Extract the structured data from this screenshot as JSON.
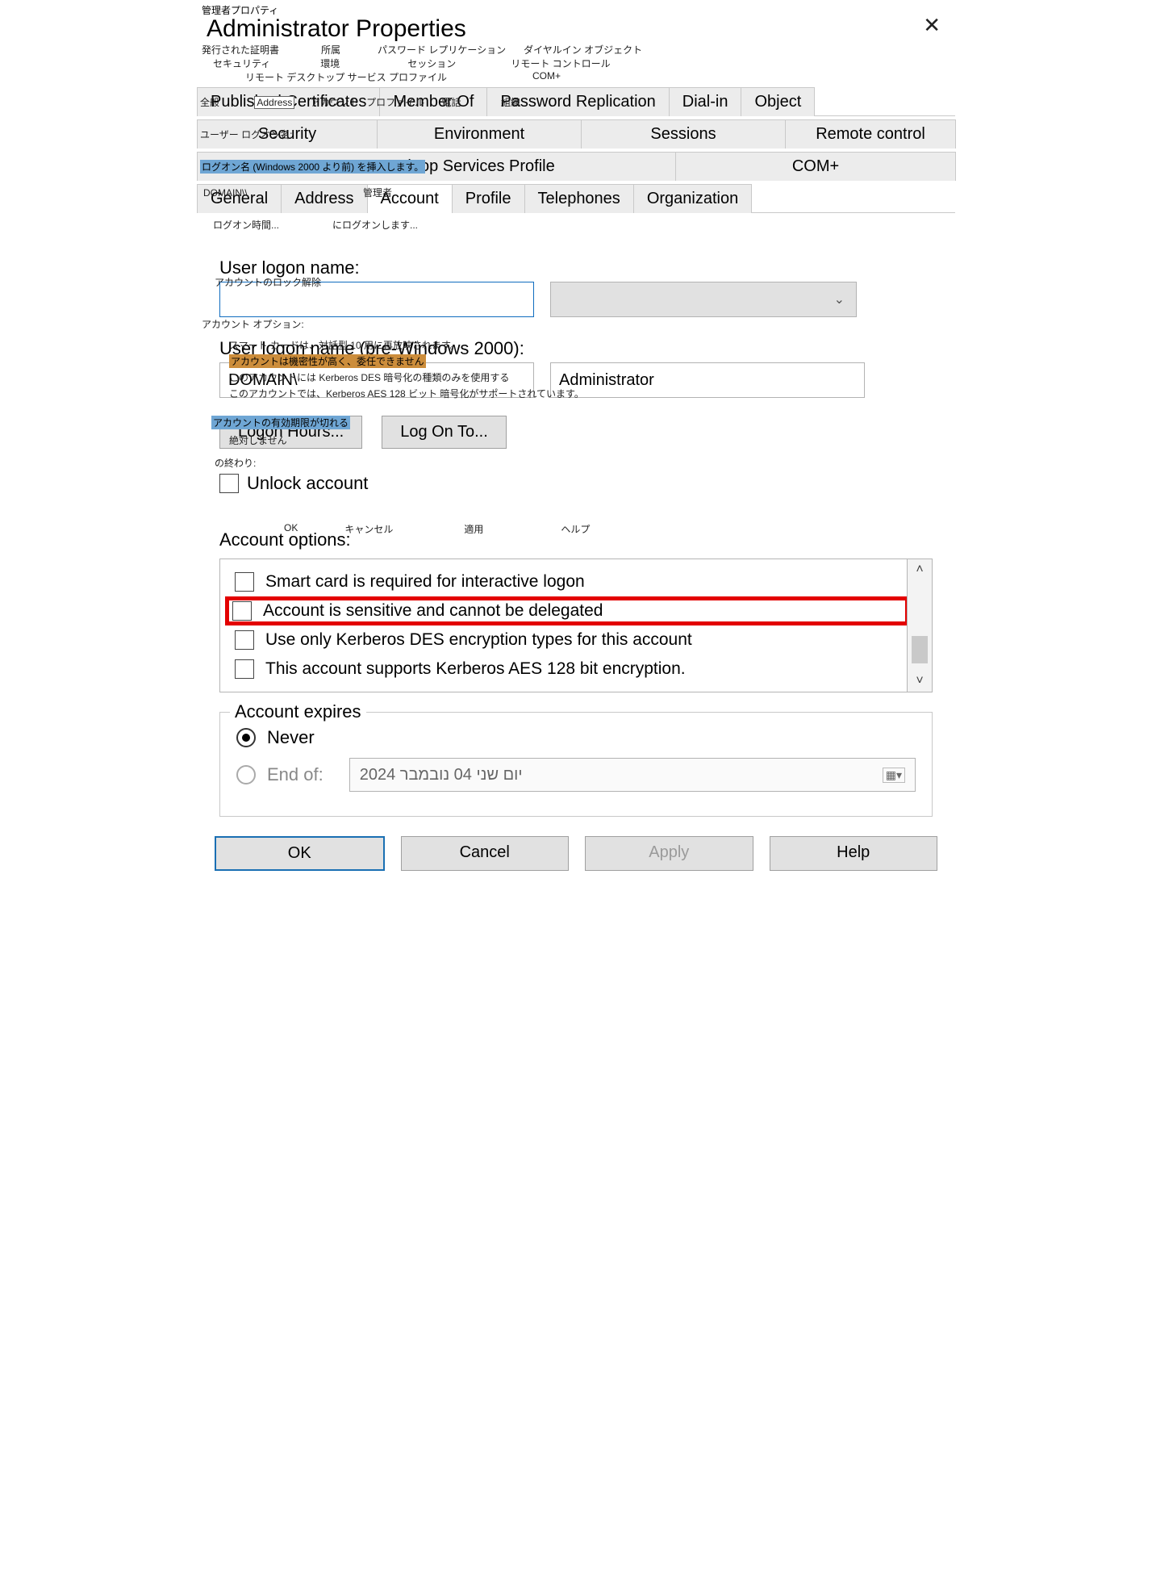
{
  "window": {
    "title_jp": "管理者プロパティ",
    "title": "Administrator Properties"
  },
  "overlay": {
    "row1": {
      "a": "発行された証明書",
      "b": "所属",
      "c": "パスワード レプリケーション",
      "d": "ダイヤルイン オブジェクト"
    },
    "row2": {
      "a": "セキュリティ",
      "b": "環境",
      "c": "セッション",
      "d": "リモート コントロール"
    },
    "row3": {
      "a": "リモート デスクトップ サービス プロファイル",
      "b": "COM+"
    },
    "row4": {
      "a": "全般",
      "b": "Address",
      "c": "アカウント",
      "d": "プロファイル",
      "e": "電話",
      "f": "組織"
    },
    "row5": {
      "a": "ユーザー ログオン名:"
    },
    "row6": {
      "a": "ログオン名 (Windows  2000 より前) を挿入します。"
    },
    "row7": {
      "a": "DOMAIN\\\\",
      "b": "管理者"
    },
    "row8": {
      "a": "ログオン時間...",
      "b": "にログオンします..."
    },
    "opts_jp": {
      "unlock": "アカウントのロック解除",
      "label": "アカウント オプション:",
      "o1": "スマート カードは、対話型 10 用に再放映されます。",
      "o2": "アカウントは機密性が高く、委任できません",
      "o3": "このアカウントには Kerberos DES 暗号化の種類のみを使用する",
      "o4": "このアカウントでは、Kerberos AES 128 ビット 暗号化がサポートされています。"
    },
    "expires_jp": {
      "head": "アカウントの有効期限が切れる",
      "never": "絶対しません",
      "end": "の終わり:"
    },
    "buttons_jp": {
      "ok": "OK",
      "cancel": "キャンセル",
      "apply": "適用",
      "help": "ヘルプ"
    }
  },
  "tabs_upper": [
    "Published Certificates",
    "Member Of",
    "Password Replication",
    "Dial-in",
    "Object"
  ],
  "tabs_mid": [
    "Security",
    "Environment",
    "Sessions",
    "Remote control"
  ],
  "tabs_mid2": [
    "Remote Desktop Services Profile",
    "COM+"
  ],
  "tabs_lower": [
    "General",
    "Address",
    "Account",
    "Profile",
    "Telephones",
    "Organization"
  ],
  "active_tab": "Account",
  "account": {
    "logon_label": "User logon name:",
    "logon_pre_label": "User logon name (pre-Windows 2000):",
    "domain_value": "DOMAIN\\",
    "user_value": "Administrator",
    "logon_hours_btn": "Logon Hours...",
    "logon_to_btn": "Log On To...",
    "unlock_label": "Unlock account",
    "options_label": "Account options:",
    "options": [
      "Smart card is required for interactive logon",
      "Account is sensitive and cannot be delegated",
      "Use only Kerberos DES encryption types for this account",
      "This account supports Kerberos AES 128 bit encryption."
    ],
    "expires": {
      "legend": "Account expires",
      "never": "Never",
      "end_of": "End of:",
      "date": "יום שני   04  נובמבר  2024"
    }
  },
  "footer": {
    "ok": "OK",
    "cancel": "Cancel",
    "apply": "Apply",
    "help": "Help"
  }
}
